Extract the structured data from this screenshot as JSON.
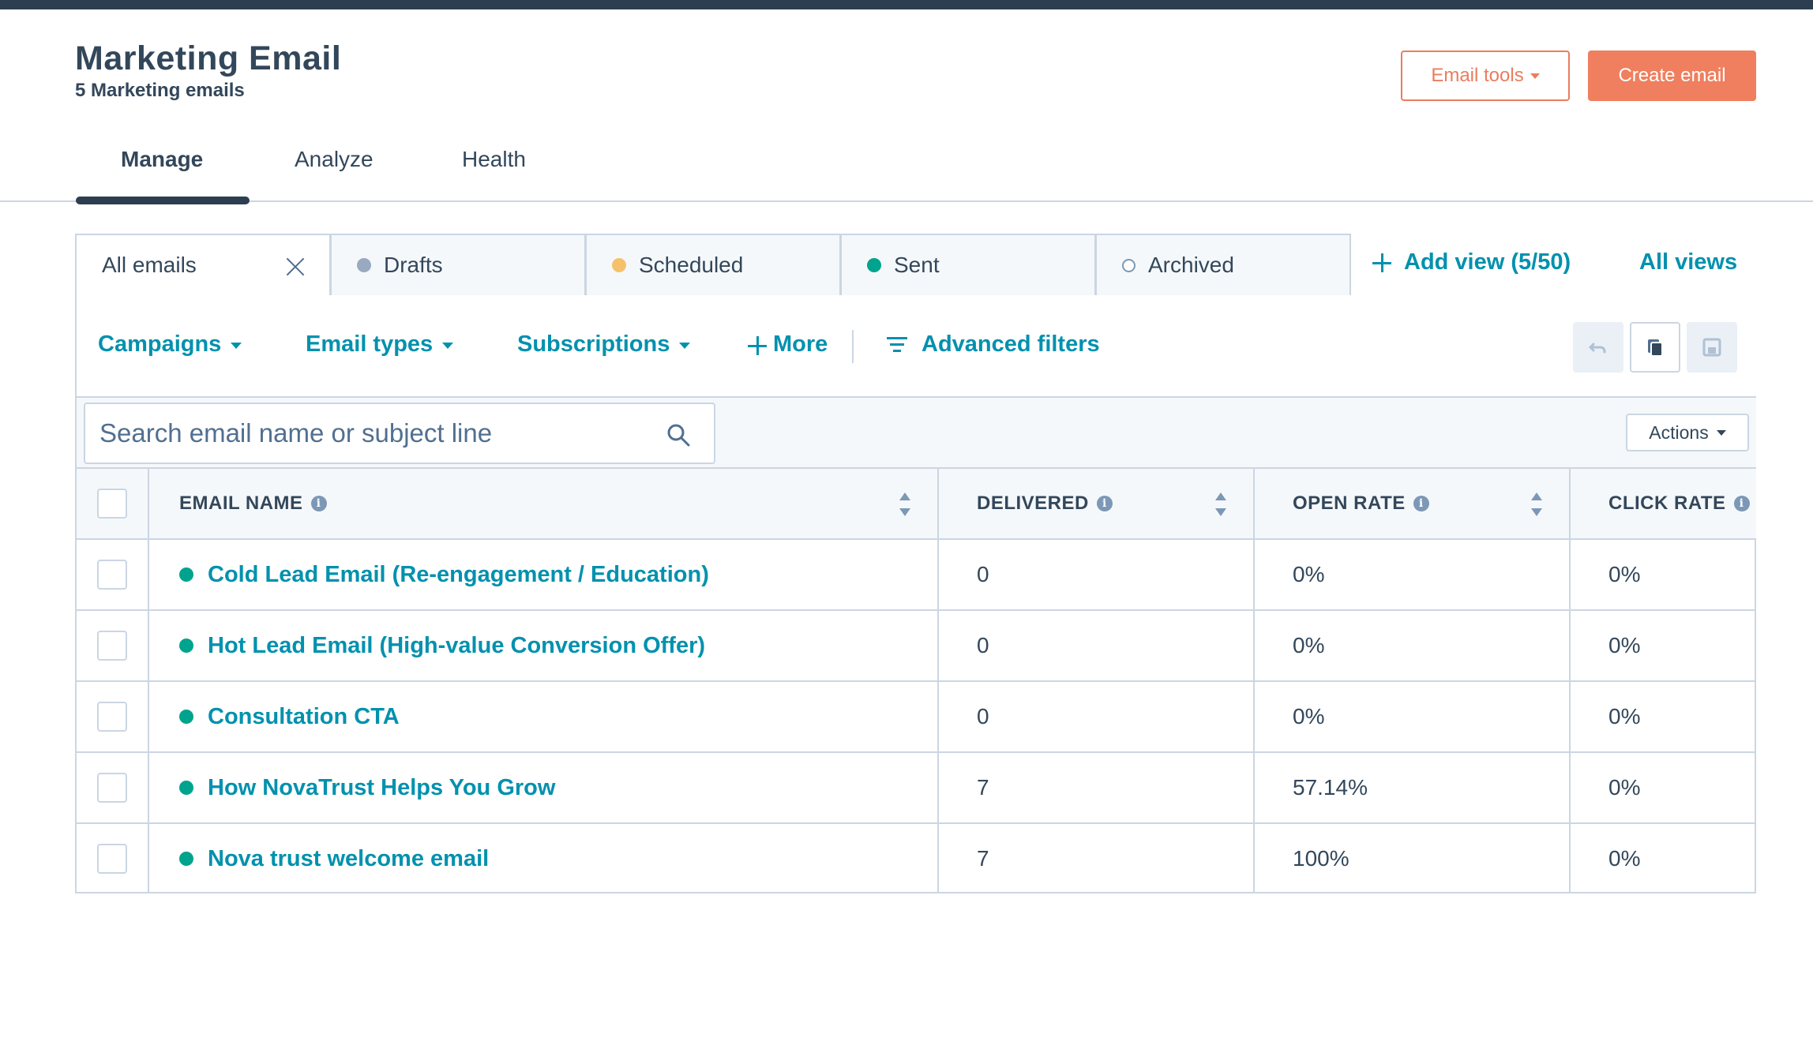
{
  "header": {
    "title": "Marketing Email",
    "subtitle": "5 Marketing emails",
    "email_tools_label": "Email tools",
    "create_email_label": "Create email",
    "accent_color": "#ef7f5e"
  },
  "tabs": [
    {
      "label": "Manage",
      "active": true
    },
    {
      "label": "Analyze",
      "active": false
    },
    {
      "label": "Health",
      "active": false
    }
  ],
  "view_tabs": [
    {
      "label": "All emails",
      "active": true,
      "icon": "close-icon"
    },
    {
      "label": "Drafts",
      "dot_color": "#99a9bf"
    },
    {
      "label": "Scheduled",
      "dot_color": "#f5c26b"
    },
    {
      "label": "Sent",
      "dot_color": "#00a38d"
    },
    {
      "label": "Archived",
      "dot": "outline"
    }
  ],
  "add_view_label": "Add view (5/50)",
  "all_views_label": "All views",
  "filters": {
    "campaigns": "Campaigns",
    "email_types": "Email types",
    "subscriptions": "Subscriptions",
    "more": "More",
    "advanced": "Advanced filters"
  },
  "search": {
    "placeholder": "Search email name or subject line",
    "value": ""
  },
  "actions_label": "Actions",
  "table": {
    "columns": [
      "EMAIL NAME",
      "DELIVERED",
      "OPEN RATE",
      "CLICK RATE"
    ],
    "rows": [
      {
        "name": "Cold Lead Email (Re-engagement / Education)",
        "delivered": "0",
        "open_rate": "0%",
        "click_rate": "0%"
      },
      {
        "name": "Hot Lead Email (High-value Conversion Offer)",
        "delivered": "0",
        "open_rate": "0%",
        "click_rate": "0%"
      },
      {
        "name": "Consultation CTA",
        "delivered": "0",
        "open_rate": "0%",
        "click_rate": "0%"
      },
      {
        "name": "How NovaTrust Helps You Grow",
        "delivered": "7",
        "open_rate": "57.14%",
        "click_rate": "0%"
      },
      {
        "name": "Nova trust welcome email",
        "delivered": "7",
        "open_rate": "100%",
        "click_rate": "0%"
      }
    ]
  }
}
